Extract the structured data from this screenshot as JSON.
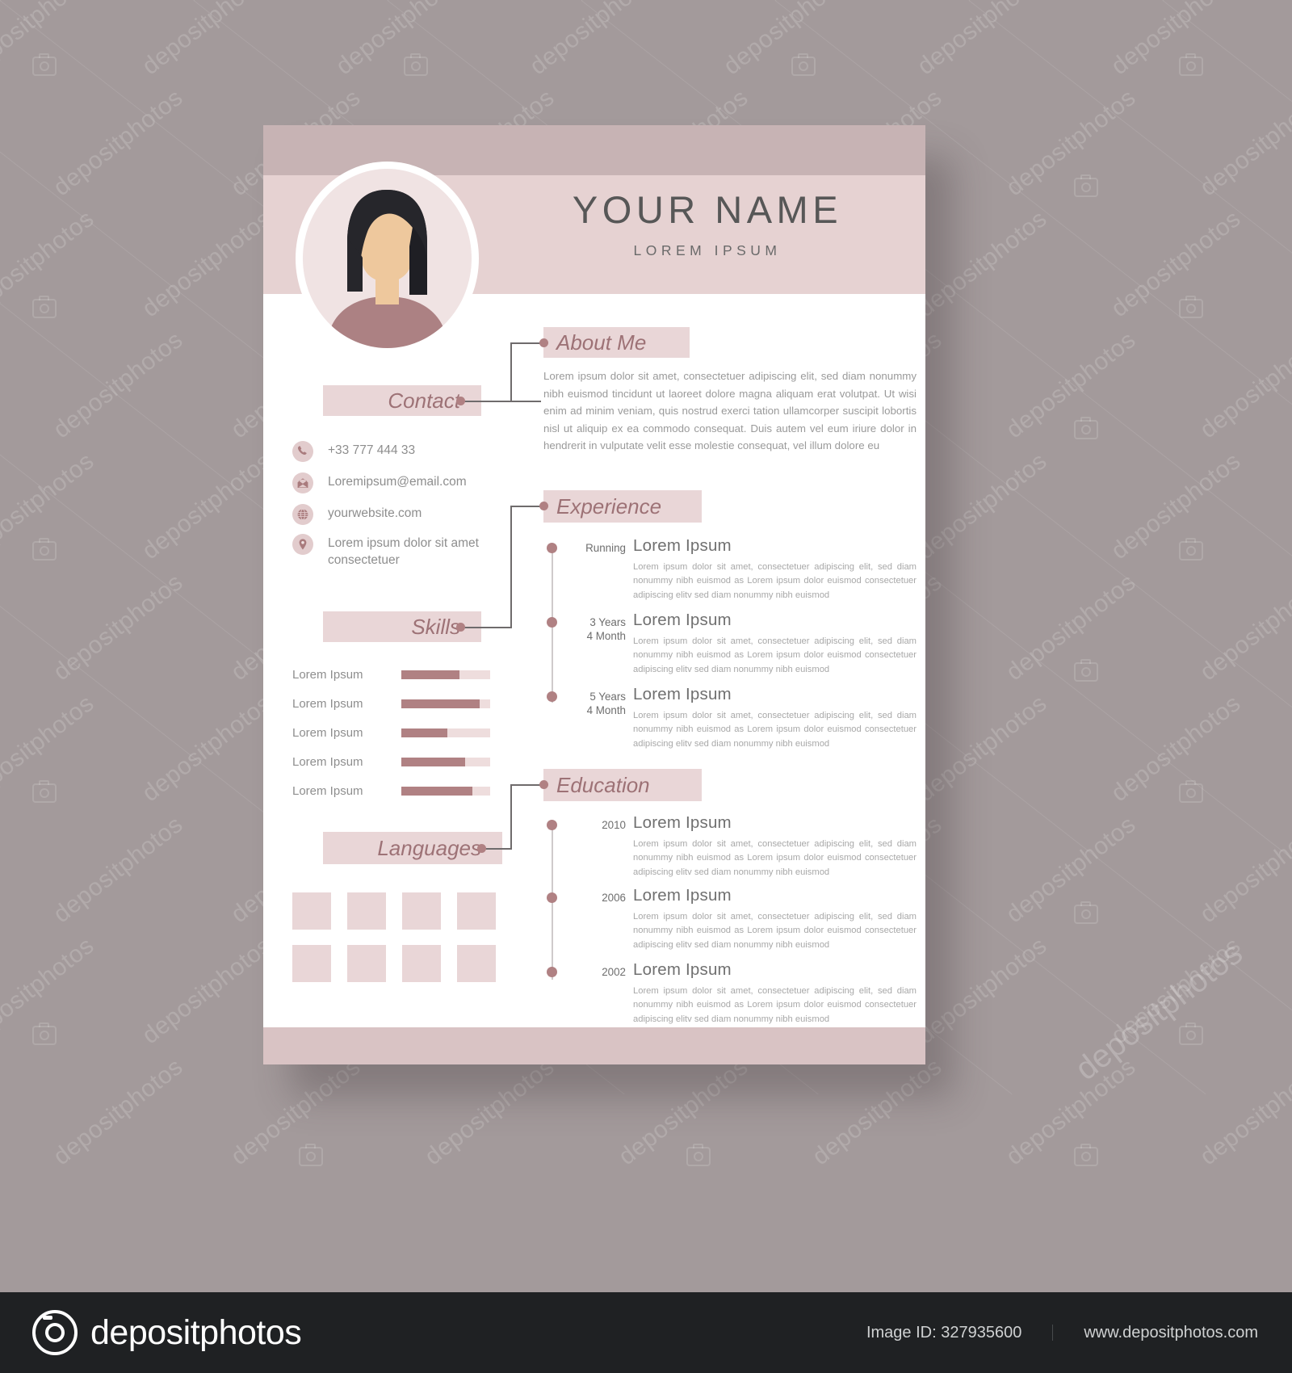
{
  "colors": {
    "backdrop": "#a39a9b",
    "band_dark": "#c7b3b4",
    "band_name": "#e6d2d2",
    "band_bottom": "#d9c3c4",
    "accent_pink": "#e9d6d7",
    "accent_rose": "#b08183",
    "heading_text": "#9d7276",
    "body_text": "#9a9a9a",
    "footer_bg": "#1f2123"
  },
  "header": {
    "name": "YOUR NAME",
    "subtitle": "LOREM IPSUM"
  },
  "sections": {
    "about": {
      "label": "About Me",
      "paragraph": "Lorem ipsum dolor sit amet, consectetuer adipiscing elit, sed diam nonummy nibh euismod tincidunt ut laoreet dolore magna aliquam erat volutpat. Ut wisi enim ad minim veniam, quis nostrud exerci tation ullamcorper suscipit lobortis nisl ut aliquip ex ea commodo consequat. Duis autem vel eum iriure dolor in hendrerit in vulputate velit esse molestie consequat, vel illum dolore eu"
    },
    "contact": {
      "label": "Contact",
      "items": [
        {
          "icon": "phone-icon",
          "value": "+33 777 444 33"
        },
        {
          "icon": "email-icon",
          "value": "Loremipsum@email.com"
        },
        {
          "icon": "globe-icon",
          "value": "yourwebsite.com"
        },
        {
          "icon": "location-pin-icon",
          "value": "Lorem ipsum dolor sit amet consectetuer"
        }
      ]
    },
    "skills": {
      "label": "Skills",
      "items": [
        {
          "name": "Lorem Ipsum",
          "percent": 65
        },
        {
          "name": "Lorem Ipsum",
          "percent": 88
        },
        {
          "name": "Lorem Ipsum",
          "percent": 52
        },
        {
          "name": "Lorem Ipsum",
          "percent": 72
        },
        {
          "name": "Lorem Ipsum",
          "percent": 80
        }
      ]
    },
    "languages": {
      "label": "Languages",
      "flag_count": 8
    },
    "experience": {
      "label": "Experience",
      "entries": [
        {
          "date": "Running",
          "date_line2": "",
          "title": "Lorem Ipsum",
          "description": "Lorem ipsum dolor sit amet, consectetuer adipiscing elit, sed diam nonummy nibh euismod as Lorem ipsum dolor euismod consectetuer adipiscing elitv sed diam nonummy nibh euismod"
        },
        {
          "date": "3 Years",
          "date_line2": "4 Month",
          "title": "Lorem Ipsum",
          "description": "Lorem ipsum dolor sit amet, consectetuer adipiscing elit, sed diam nonummy nibh euismod as Lorem ipsum dolor euismod consectetuer adipiscing elitv sed diam nonummy nibh euismod"
        },
        {
          "date": "5 Years",
          "date_line2": "4 Month",
          "title": "Lorem Ipsum",
          "description": "Lorem ipsum dolor sit amet, consectetuer adipiscing elit, sed diam nonummy nibh euismod as Lorem ipsum dolor euismod consectetuer adipiscing elitv sed diam nonummy nibh euismod"
        }
      ]
    },
    "education": {
      "label": "Education",
      "entries": [
        {
          "date": "2010",
          "title": "Lorem Ipsum",
          "description": "Lorem ipsum dolor sit amet, consectetuer adipiscing elit, sed diam nonummy nibh euismod as Lorem ipsum dolor euismod consectetuer adipiscing elitv sed diam nonummy nibh euismod"
        },
        {
          "date": "2006",
          "title": "Lorem Ipsum",
          "description": "Lorem ipsum dolor sit amet, consectetuer adipiscing elit, sed diam nonummy nibh euismod as Lorem ipsum dolor euismod consectetuer adipiscing elitv sed diam nonummy nibh euismod"
        },
        {
          "date": "2002",
          "title": "Lorem Ipsum",
          "description": "Lorem ipsum dolor sit amet, consectetuer adipiscing elit, sed diam nonummy nibh euismod as Lorem ipsum dolor euismod consectetuer adipiscing elitv sed diam nonummy nibh euismod"
        }
      ]
    }
  },
  "watermark": {
    "text": "depositphotos",
    "icon": "camera-icon"
  },
  "footer": {
    "brand": "depositphotos",
    "image_id": "Image ID: 327935600",
    "site": "www.depositphotos.com"
  }
}
